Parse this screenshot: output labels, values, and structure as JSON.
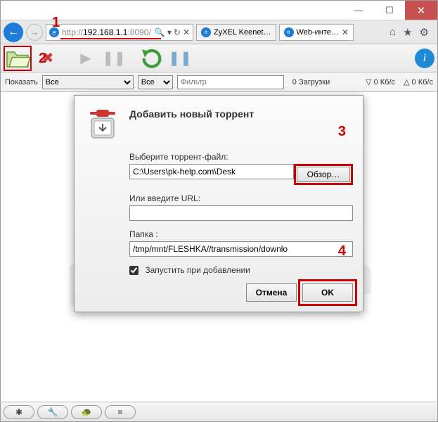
{
  "window": {
    "min": "—",
    "max": "☐",
    "close": "✕"
  },
  "nav": {
    "url_prefix": "http://",
    "url_host": "192.168.1.1",
    "url_port": ":8090/",
    "search_glyph": "🔍",
    "dd": "▾",
    "refresh": "↻",
    "stop": "✕"
  },
  "tabs": [
    {
      "label": "ZyXEL Keenet…",
      "active": false
    },
    {
      "label": "Web-инте…",
      "close": "✕",
      "active": true
    }
  ],
  "navicons": {
    "home": "⌂",
    "fav": "★",
    "gear": "⚙"
  },
  "toolbar": {
    "open": "📂",
    "remove": "✖",
    "start": "▶",
    "pause": "❚❚",
    "resume_all": "↻",
    "pause_all": "❚❚",
    "info": "i"
  },
  "filter": {
    "label": "Показать",
    "all": "Все",
    "tracker_all": "Все",
    "placeholder": "Фильтр",
    "count": "0 Загрузки",
    "dl": "▽ 0 Кб/с",
    "ul": "△ 0 Кб/с"
  },
  "dialog": {
    "title": "Добавить новый торрент",
    "file_label": "Выберите торрент-файл:",
    "file_value": "C:\\Users\\pk-help.com\\Desk",
    "browse": "Обзор…",
    "url_label": "Или введите URL:",
    "url_value": "",
    "folder_label": "Папка :",
    "folder_value": "/tmp/mnt/FLESHKA//transmission/downlo",
    "start_chk": "Запустить при добавлении",
    "cancel": "Отмена",
    "ok": "OK"
  },
  "footer": {
    "settings": "✱",
    "prefs": "🔧",
    "turtle": "🐢",
    "compact": "≡"
  },
  "watermark": "pk-help.com",
  "ann": {
    "s1": "1",
    "s2": "2",
    "s3": "3",
    "s4": "4"
  }
}
